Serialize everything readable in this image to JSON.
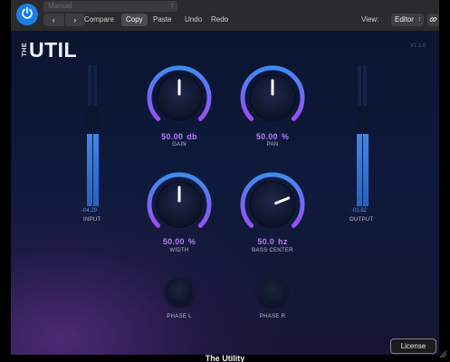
{
  "host": {
    "preset_name": "Manual",
    "nav": {
      "prev": "‹",
      "next": "›"
    },
    "compare": "Compare",
    "copy": "Copy",
    "paste": "Paste",
    "undo": "Undo",
    "redo": "Redo",
    "view_label": "View:",
    "view_value": "Editor",
    "icons": {
      "power": "power-icon",
      "link": "link-icon",
      "caret": "chevron-updown-icon"
    }
  },
  "plugin": {
    "logo_the": "THE",
    "logo_util": "UTIL",
    "version": "V1.1.0",
    "input": {
      "label": "INPUT",
      "value": "-04.29",
      "level": 0.72
    },
    "output": {
      "label": "OUTPUT",
      "value": "-03.82",
      "level": 0.72
    },
    "knobs": [
      {
        "id": "gain",
        "value": "50.00",
        "unit": "db",
        "label": "GAIN"
      },
      {
        "id": "pan",
        "value": "50.00",
        "unit": "%",
        "label": "PAN"
      },
      {
        "id": "width",
        "value": "50.00",
        "unit": "%",
        "label": "WIDTH"
      },
      {
        "id": "bass",
        "value": "50.0",
        "unit": "hz",
        "label": "BASS CENTER"
      }
    ],
    "phase_l": {
      "label": "PHASE  L"
    },
    "phase_r": {
      "label": "PHASE  R"
    }
  },
  "footer": {
    "license": "License",
    "title": "The Utility"
  },
  "colors": {
    "accent_blue": "#3d8cf0",
    "accent_purple": "#9b4df2",
    "value_text": "#b77cf4",
    "host_power": "#1c7ee8"
  }
}
